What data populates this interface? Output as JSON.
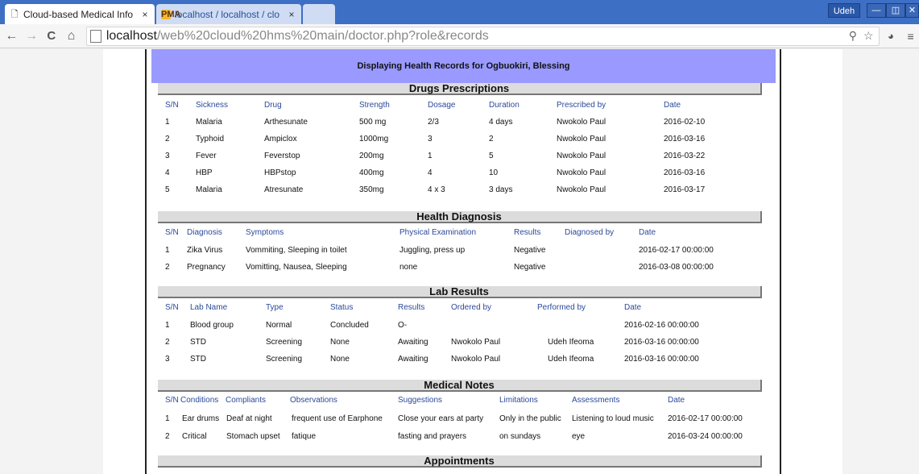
{
  "browser": {
    "tabs": [
      {
        "title": "Cloud-based Medical Info",
        "close": "×"
      },
      {
        "title": "localhost / localhost / clo",
        "close": "×"
      },
      {
        "title": "",
        "close": ""
      }
    ],
    "pma_icon_text": "PMA",
    "user_label": "Udeh",
    "window_buttons": [
      "—",
      "◫",
      "✕"
    ],
    "url_host": "localhost",
    "url_path": "/web%20cloud%20hms%20main/doctor.php?role&records",
    "nav": {
      "back": "←",
      "forward": "→",
      "reload": "C",
      "home": "⌂"
    },
    "omni_icons": [
      "⚲",
      "☆",
      "◕",
      "≡"
    ]
  },
  "page": {
    "heading": "Displaying Health Records for Ogbuokiri, Blessing",
    "drugs": {
      "title": "Drugs Prescriptions",
      "headers": [
        "S/N",
        "Sickness",
        "Drug",
        "Strength",
        "Dosage",
        "Duration",
        "Prescribed by",
        "Date"
      ],
      "rows": [
        [
          "1",
          "Malaria",
          "Arthesunate",
          "500 mg",
          "2/3",
          "4 days",
          "Nwokolo Paul",
          "2016-02-10"
        ],
        [
          "2",
          "Typhoid",
          "Ampiclox",
          "1000mg",
          "3",
          "2",
          "Nwokolo Paul",
          "2016-03-16"
        ],
        [
          "3",
          "Fever",
          "Feverstop",
          "200mg",
          "1",
          "5",
          "Nwokolo Paul",
          "2016-03-22"
        ],
        [
          "4",
          "HBP",
          "HBPstop",
          "400mg",
          "4",
          "10",
          "Nwokolo Paul",
          "2016-03-16"
        ],
        [
          "5",
          "Malaria",
          "Atresunate",
          "350mg",
          "4 x 3",
          "3 days",
          "Nwokolo Paul",
          "2016-03-17"
        ]
      ]
    },
    "diagnosis": {
      "title": "Health Diagnosis",
      "headers": [
        "S/N",
        "Diagnosis",
        "Symptoms",
        "Physical Examination",
        "Results",
        "Diagnosed by",
        "Date"
      ],
      "rows": [
        [
          "1",
          "Zika Virus",
          "Vommiting, Sleeping in toilet",
          "Juggling, press up",
          "Negative",
          "",
          "2016-02-17 00:00:00"
        ],
        [
          "2",
          "Pregnancy",
          "Vomitting, Nausea, Sleeping",
          "none",
          "Negative",
          "",
          "2016-03-08 00:00:00"
        ]
      ]
    },
    "lab": {
      "title": "Lab Results",
      "headers": [
        "S/N",
        "Lab Name",
        "Type",
        "Status",
        "Results",
        "Ordered by",
        "Performed by",
        "Date"
      ],
      "rows": [
        [
          "1",
          "Blood group",
          "Normal",
          "Concluded",
          "O-",
          "",
          "",
          "2016-02-16 00:00:00"
        ],
        [
          "2",
          "STD",
          "Screening",
          "None",
          "Awaiting",
          "Nwokolo Paul",
          "Udeh Ifeoma",
          "2016-03-16 00:00:00"
        ],
        [
          "3",
          "STD",
          "Screening",
          "None",
          "Awaiting",
          "Nwokolo Paul",
          "Udeh Ifeoma",
          "2016-03-16 00:00:00"
        ]
      ]
    },
    "notes": {
      "title": "Medical Notes",
      "headers": [
        "S/N",
        "Conditions",
        "Compliants",
        "Observations",
        "Suggestions",
        "Limitations",
        "Assessments",
        "Date"
      ],
      "rows": [
        [
          "1",
          "Ear drums",
          "Deaf at night",
          "frequent use of Earphone",
          "Close your ears at party",
          "Only in the public",
          "Listening to loud music",
          "2016-02-17 00:00:00"
        ],
        [
          "2",
          "Critical",
          "Stomach upset",
          "fatique",
          "fasting and prayers",
          "on sundays",
          "eye",
          "2016-03-24 00:00:00"
        ]
      ]
    },
    "appointments": {
      "title": "Appointments"
    }
  }
}
